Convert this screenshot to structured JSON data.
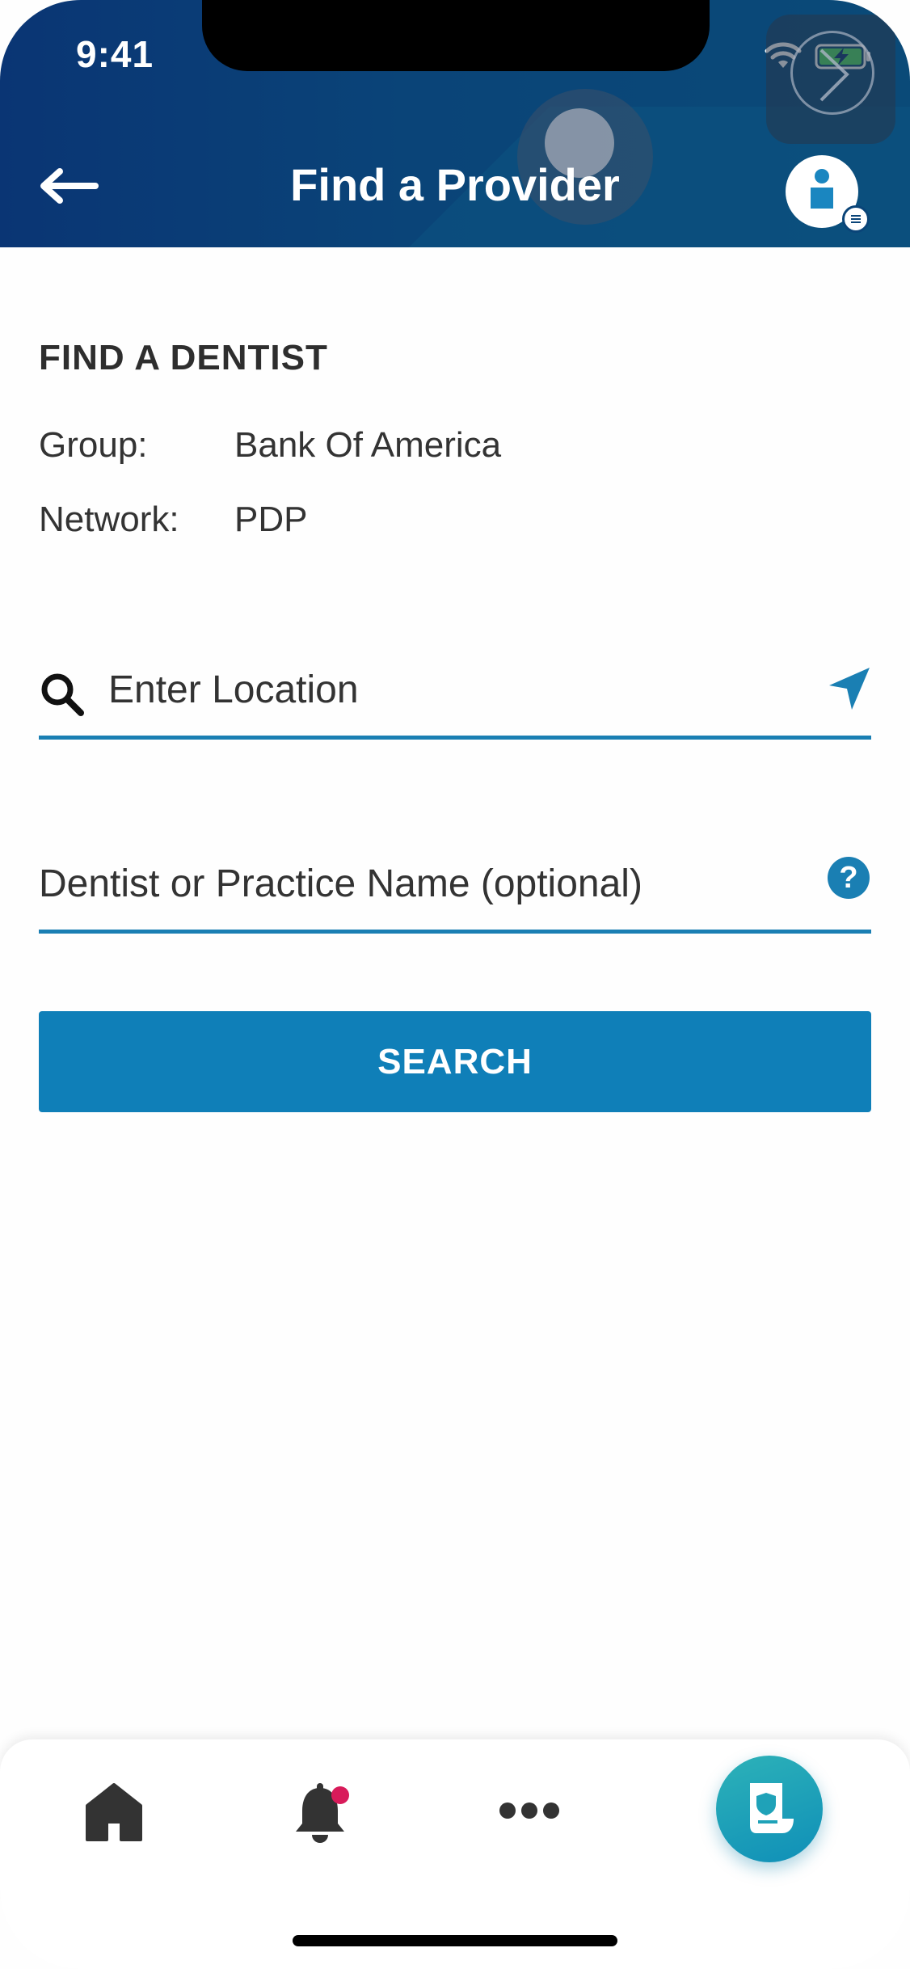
{
  "status_bar": {
    "time": "9:41"
  },
  "header": {
    "title": "Find a Provider"
  },
  "section": {
    "heading": "FIND A DENTIST",
    "rows": [
      {
        "label": "Group:",
        "value": "Bank Of America"
      },
      {
        "label": "Network:",
        "value": "PDP"
      }
    ]
  },
  "location_field": {
    "placeholder": "Enter Location"
  },
  "name_field": {
    "placeholder": "Dentist or Practice Name (optional)"
  },
  "search_button": {
    "label": "SEARCH"
  },
  "colors": {
    "header": "#0a4478",
    "accent": "#0f7fb8",
    "fab": "#1fa2b8",
    "notification_dot": "#d81b5a"
  },
  "icons": {
    "back": "arrow-left-icon",
    "profile": "person-icon",
    "search": "magnifier-icon",
    "locate": "navigation-arrow-icon",
    "help": "question-mark-icon",
    "home": "home-icon",
    "notifications": "bell-icon",
    "more": "ellipsis-icon",
    "fab": "id-card-icon"
  }
}
